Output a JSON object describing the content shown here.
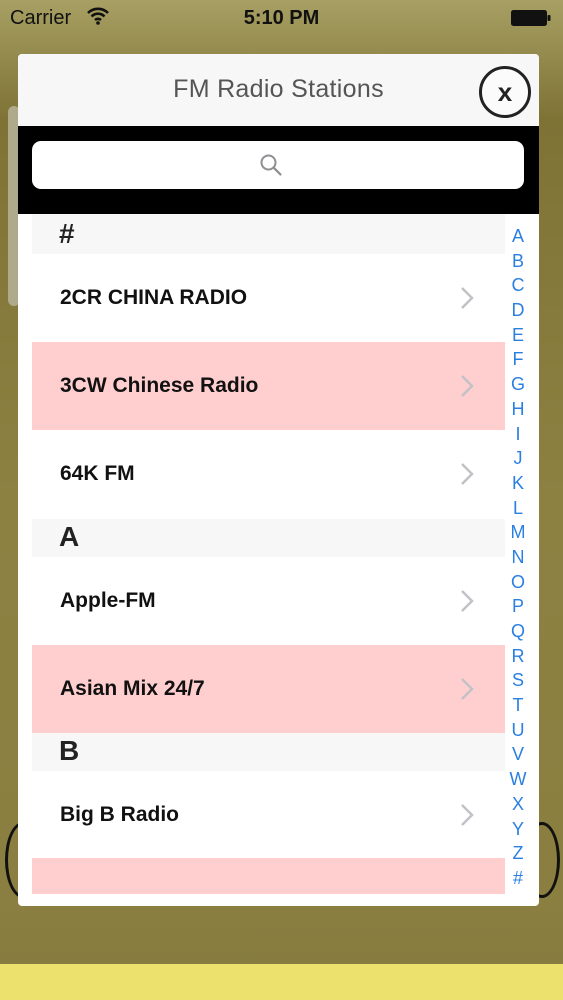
{
  "status": {
    "carrier": "Carrier",
    "time": "5:10 PM"
  },
  "modal": {
    "title": "FM Radio Stations",
    "close_label": "x"
  },
  "search": {
    "placeholder": ""
  },
  "sections": [
    {
      "header": "#",
      "rows": [
        "2CR CHINA RADIO",
        "3CW Chinese Radio",
        "64K FM"
      ]
    },
    {
      "header": "A",
      "rows": [
        "Apple-FM",
        "Asian Mix 24/7"
      ]
    },
    {
      "header": "B",
      "rows": [
        "Big B Radio",
        ""
      ]
    }
  ],
  "index_letters": [
    "A",
    "B",
    "C",
    "D",
    "E",
    "F",
    "G",
    "H",
    "I",
    "J",
    "K",
    "L",
    "M",
    "N",
    "O",
    "P",
    "Q",
    "R",
    "S",
    "T",
    "U",
    "V",
    "W",
    "X",
    "Y",
    "Z",
    "#"
  ],
  "colors": {
    "row_alt": "#ffcfcf",
    "index": "#2a7fe0",
    "search_band": "#000000"
  }
}
